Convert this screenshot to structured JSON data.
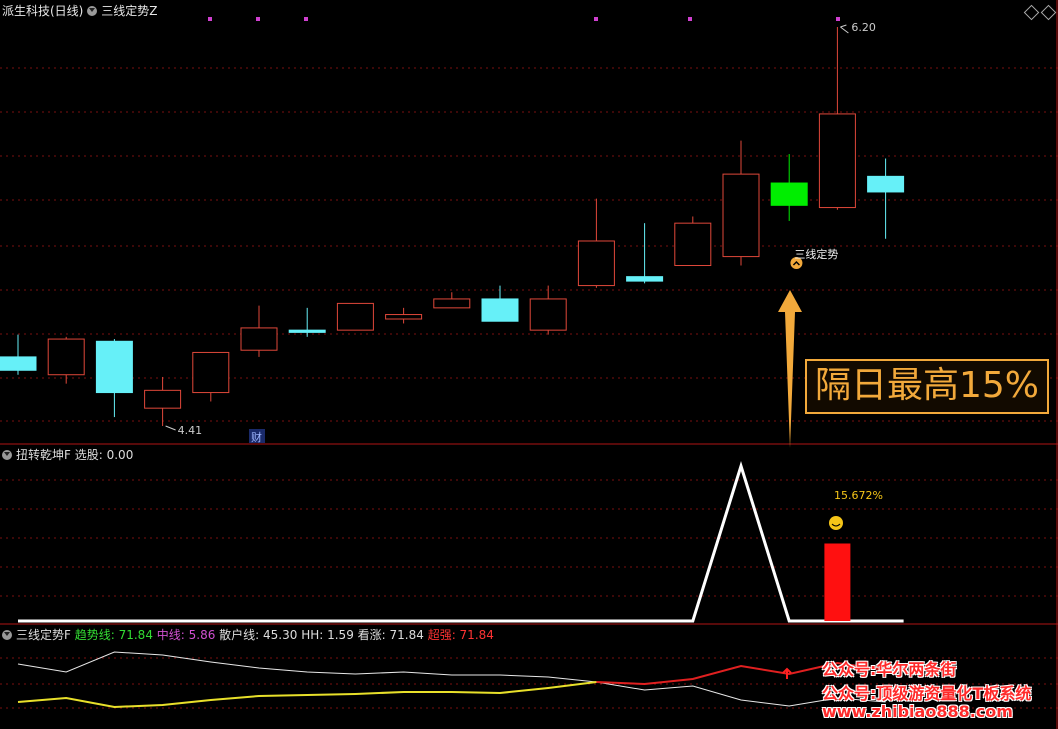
{
  "main_panel": {
    "stock": "派生科技(日线)",
    "indicator": "三线定势Z",
    "high_label": "6.20",
    "low_label": "4.41",
    "cai_badge": "财",
    "signal_label": "三线定势",
    "callout": "隔日最高15%"
  },
  "sub_panel": {
    "name": "扭转乾坤F",
    "field_label": "选股:",
    "field_value": "0.00",
    "percent_label": "15.672%"
  },
  "bottom_panel": {
    "name": "三线定势F",
    "fields": [
      {
        "label": "趋势线:",
        "value": "71.84",
        "color": "#33dd33"
      },
      {
        "label": "中线:",
        "value": "5.86",
        "color": "#d050d0"
      },
      {
        "label": "散户线:",
        "value": "45.30",
        "color": "#dddddd"
      },
      {
        "label": "HH:",
        "value": "1.59",
        "color": "#dddddd"
      },
      {
        "label": "看涨:",
        "value": "71.84",
        "color": "#dddddd"
      },
      {
        "label": "超强:",
        "value": "71.84",
        "color": "#ff3333"
      }
    ]
  },
  "watermark": {
    "line1": "公众号:华尔两条街",
    "line2": "公众号:顶级游资量化T板系统",
    "line3": "www.zhibiao888.com"
  },
  "colors": {
    "up": "#e0483a",
    "down": "#66f0f8",
    "signal_green": "#00ee00",
    "arrow": "#f2a93b",
    "grid": "#7a1010",
    "magenta": "#d040d0"
  },
  "chart_data": {
    "type": "candlestick",
    "candles": [
      {
        "open": 4.72,
        "close": 4.66,
        "high": 4.82,
        "low": 4.64
      },
      {
        "open": 4.64,
        "close": 4.8,
        "high": 4.81,
        "low": 4.6
      },
      {
        "open": 4.79,
        "close": 4.56,
        "high": 4.8,
        "low": 4.45
      },
      {
        "open": 4.49,
        "close": 4.57,
        "high": 4.63,
        "low": 4.41
      },
      {
        "open": 4.56,
        "close": 4.74,
        "high": 4.74,
        "low": 4.52
      },
      {
        "open": 4.75,
        "close": 4.85,
        "high": 4.95,
        "low": 4.72
      },
      {
        "open": 4.84,
        "close": 4.83,
        "high": 4.94,
        "low": 4.81
      },
      {
        "open": 4.84,
        "close": 4.96,
        "high": 4.96,
        "low": 4.84
      },
      {
        "open": 4.89,
        "close": 4.91,
        "high": 4.94,
        "low": 4.87
      },
      {
        "open": 4.94,
        "close": 4.98,
        "high": 5.01,
        "low": 4.94
      },
      {
        "open": 4.98,
        "close": 4.88,
        "high": 5.04,
        "low": 4.88
      },
      {
        "open": 4.84,
        "close": 4.98,
        "high": 5.04,
        "low": 4.82
      },
      {
        "open": 5.04,
        "close": 5.24,
        "high": 5.43,
        "low": 5.03
      },
      {
        "open": 5.08,
        "close": 5.06,
        "high": 5.32,
        "low": 5.05
      },
      {
        "open": 5.13,
        "close": 5.32,
        "high": 5.35,
        "low": 5.13
      },
      {
        "open": 5.17,
        "close": 5.54,
        "high": 5.69,
        "low": 5.13
      },
      {
        "open": 5.5,
        "close": 5.4,
        "high": 5.63,
        "low": 5.33
      },
      {
        "open": 5.39,
        "close": 5.81,
        "high": 6.2,
        "low": 5.38
      },
      {
        "open": 5.53,
        "close": 5.46,
        "high": 5.61,
        "low": 5.25
      }
    ],
    "signal_bar_index": 16,
    "sub_line": [
      0,
      0,
      0,
      0,
      0,
      0,
      0,
      0,
      0,
      0,
      0,
      0,
      0,
      0,
      0,
      1,
      0,
      0,
      0
    ],
    "sub_bar": {
      "index": 17,
      "value": 0.5
    },
    "bottom_white": [
      48,
      40,
      60,
      57,
      50,
      44,
      40,
      38,
      40,
      37,
      37,
      35,
      30,
      22,
      26,
      12,
      6,
      14,
      10
    ],
    "bottom_yellow": [
      10,
      14,
      5,
      7,
      12,
      16,
      17,
      18,
      20,
      20,
      19,
      24,
      30
    ],
    "bottom_red": [
      30,
      28,
      33,
      46,
      38,
      49,
      42
    ]
  }
}
